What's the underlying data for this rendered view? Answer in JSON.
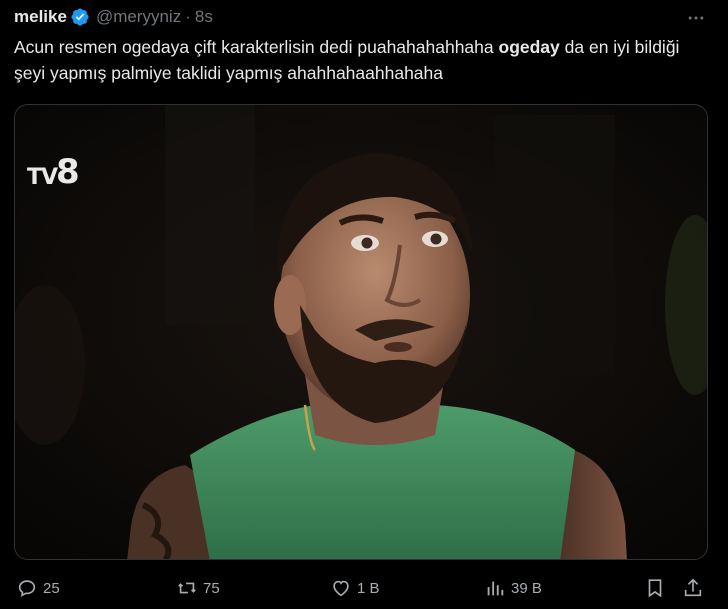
{
  "author": {
    "display_name": "melike",
    "handle": "@meryyniz",
    "separator": "·",
    "time": "8s"
  },
  "tweet": {
    "text_before": "Acun resmen ogedaya çift karakterlisin dedi puahahahahhaha ",
    "text_bold": "ogeday",
    "text_after": " da en iyi bildiği şeyi yapmış palmiye taklidi yapmış ahahhahaahhahaha"
  },
  "media": {
    "watermark_main": "TV",
    "watermark_number": "8"
  },
  "actions": {
    "replies": "25",
    "reposts": "75",
    "likes": "1 B",
    "views": "39 B"
  },
  "icons": {
    "verified": "verified-badge-icon",
    "more": "more-icon",
    "reply": "reply-icon",
    "repost": "repost-icon",
    "like": "like-icon",
    "views": "views-icon",
    "bookmark": "bookmark-icon",
    "share": "share-icon"
  },
  "colors": {
    "background": "#000000",
    "primary_text": "#e7e9ea",
    "secondary_text": "#71767b",
    "verified_blue": "#1d9bf0",
    "shirt_green": "#3f8f5e"
  }
}
